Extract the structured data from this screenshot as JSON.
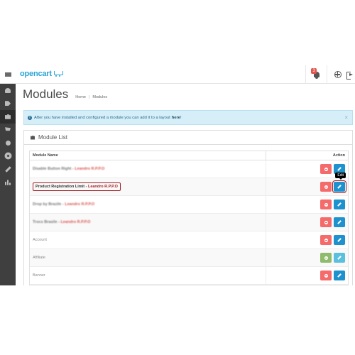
{
  "header": {
    "logo_text": "opencart",
    "alert_count": "3",
    "icons": [
      "bell-icon",
      "globe-icon",
      "sign-out-icon"
    ]
  },
  "sidebar": {
    "icons": [
      "dashboard-icon",
      "tags-icon",
      "puzzle-icon",
      "cart-icon",
      "share-icon",
      "cog-icon",
      "wrench-icon",
      "bar-chart-icon"
    ]
  },
  "page": {
    "title": "Modules",
    "breadcrumb": [
      "Home",
      "Modules"
    ]
  },
  "alert": {
    "text": "After you have installed and configured a module you can add it to a layout",
    "link": "here",
    "suffix": "!",
    "close": "×"
  },
  "panel": {
    "title": "Module List"
  },
  "table": {
    "headers": {
      "name": "Module Name",
      "action": "Action"
    },
    "rows": [
      {
        "name": "Disable Button Right",
        "author": "Leandro R.P.P.O",
        "style": "blurred"
      },
      {
        "name": "Product Registration Limit",
        "author": "Leandro R.P.P.O",
        "style": "highlight"
      },
      {
        "name": "Drop by Brazile",
        "author": "Leandro R.P.P.O",
        "style": "blurred"
      },
      {
        "name": "Trocs Brasile",
        "author": "Leandro R.P.P.O",
        "style": "blurred"
      },
      {
        "name": "Account",
        "author": "",
        "style": "plain"
      },
      {
        "name": "Affiliate",
        "author": "",
        "style": "plain"
      },
      {
        "name": "Banner",
        "author": "",
        "style": "plain"
      }
    ],
    "separator": " - "
  },
  "tooltip": {
    "edit": "Edit"
  },
  "colors": {
    "accent": "#1e91cf",
    "danger": "#f56b6b",
    "success": "#8fbb6c",
    "highlight": "#a41d22",
    "sidebar": "#3f3f3f"
  }
}
